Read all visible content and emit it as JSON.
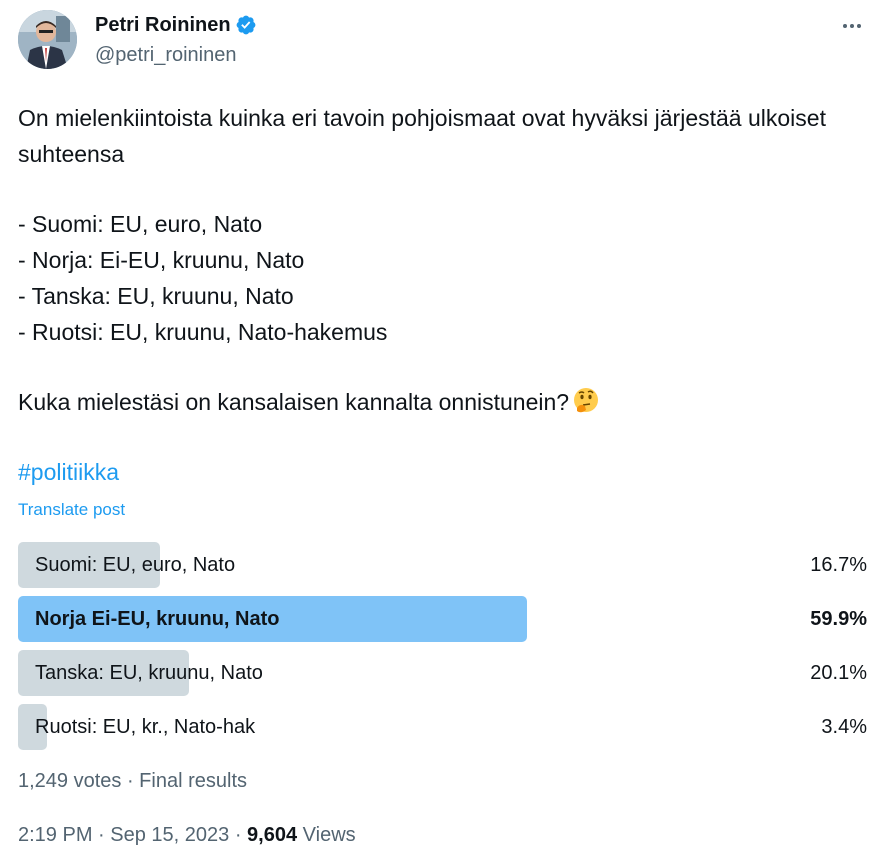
{
  "author": {
    "display_name": "Petri Roininen",
    "handle": "@petri_roininen",
    "verified": true
  },
  "post": {
    "intro": "On mielenkiintoista kuinka eri tavoin pohjoismaat ovat hyväksi järjestää ulkoiset suhteensa",
    "lines": [
      "- Suomi: EU, euro, Nato",
      "- Norja: Ei-EU, kruunu, Nato",
      "- Tanska: EU, kruunu, Nato",
      "- Ruotsi: EU, kruunu, Nato-hakemus"
    ],
    "question": "Kuka mielestäsi on kansalaisen kannalta onnistunein?",
    "question_emoji": "thinking-face-icon",
    "hashtag": "#politiikka",
    "translate_label": "Translate post"
  },
  "poll": {
    "options": [
      {
        "label": "Suomi: EU, euro, Nato",
        "percent_text": "16.7%",
        "percent": 16.7,
        "winner": false
      },
      {
        "label": "Norja Ei-EU, kruunu, Nato",
        "percent_text": "59.9%",
        "percent": 59.9,
        "winner": true
      },
      {
        "label": "Tanska: EU, kruunu, Nato",
        "percent_text": "20.1%",
        "percent": 20.1,
        "winner": false
      },
      {
        "label": "Ruotsi: EU, kr., Nato-hak",
        "percent_text": "3.4%",
        "percent": 3.4,
        "winner": false
      }
    ],
    "footer": "1,249 votes · Final results"
  },
  "meta": {
    "time": "2:19 PM",
    "sep1": " · ",
    "date": "Sep 15, 2023",
    "sep2": " · ",
    "views_count": "9,604",
    "views_label": " Views"
  },
  "colors": {
    "accent": "#1d9bf0",
    "poll_bar": "#cfd9de",
    "poll_bar_winner": "#7fc3f7",
    "muted_text": "#536471"
  },
  "icons": {
    "verified": "verified-badge-icon",
    "more": "more-options-icon"
  }
}
